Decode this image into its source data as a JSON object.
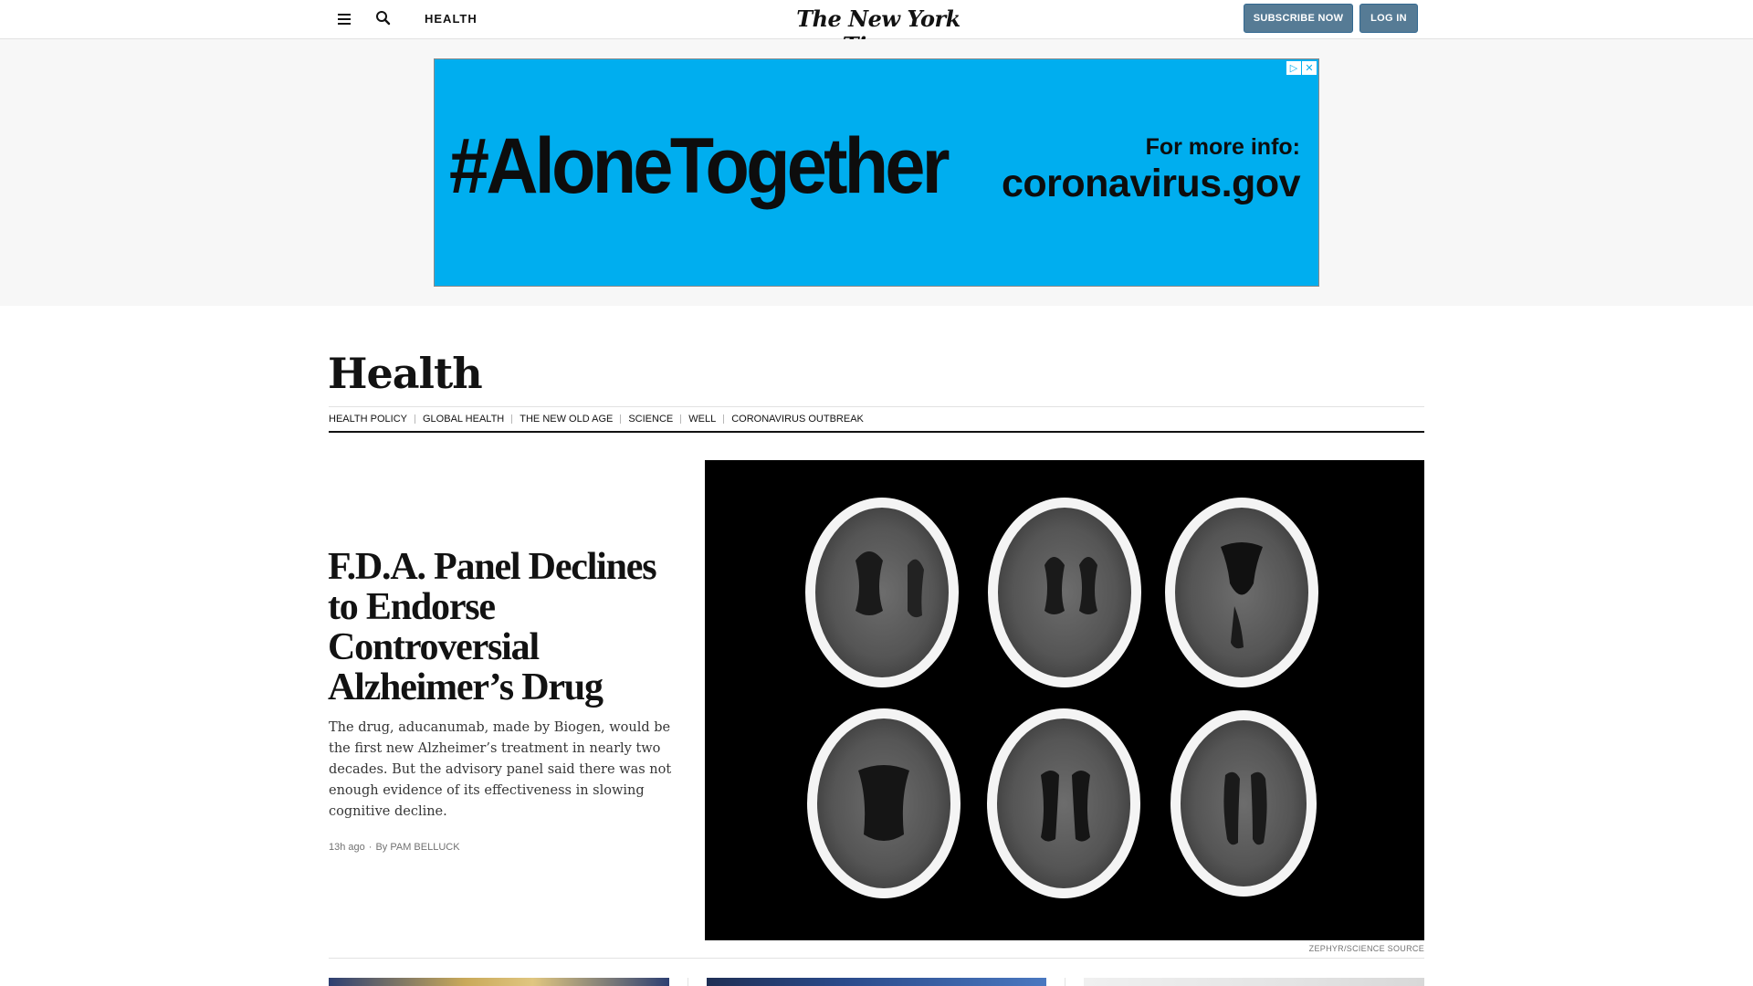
{
  "topbar": {
    "section_label": "HEALTH",
    "masthead": "The New York Times",
    "subscribe_label": "SUBSCRIBE NOW",
    "login_label": "LOG IN",
    "icons": [
      "menu-icon",
      "search-icon"
    ]
  },
  "ad": {
    "hashtag": "#AloneTogether",
    "info_label": "For more info:",
    "info_url": "coronavirus.gov",
    "background_color": "#00aeef",
    "adchoices_icons": [
      "adchoices-icon",
      "close-icon"
    ]
  },
  "section": {
    "title": "Health",
    "subnav": [
      "HEALTH POLICY",
      "GLOBAL HEALTH",
      "THE NEW OLD AGE",
      "SCIENCE",
      "WELL",
      "CORONAVIRUS OUTBREAK"
    ]
  },
  "lead": {
    "headline": "F.D.A. Panel Declines to Endorse Controversial Alzheimer’s Drug",
    "summary": "The drug, aducanumab, made by Biogen, would be the first new Alzheimer’s treatment in nearly two decades. But the advisory panel said there was not enough evidence of its effectiveness in slowing cognitive decline.",
    "timestamp": "13h ago",
    "separator": "·",
    "byline": "By PAM BELLUCK",
    "image_credit": "ZEPHYR/SCIENCE SOURCE"
  },
  "colors": {
    "button_bg": "#567b95",
    "text": "#121212",
    "ad_bg": "#00aeef"
  }
}
